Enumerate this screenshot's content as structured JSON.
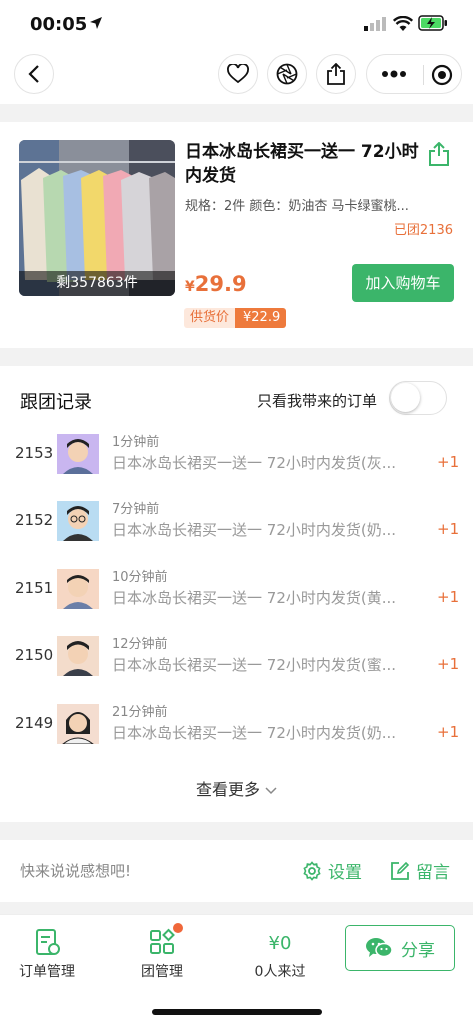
{
  "status_bar": {
    "time": "00:05"
  },
  "product": {
    "title": "日本冰岛长裙买一送一 72小时内发货",
    "spec": "规格：2件 颜色：奶油杏 马卡绿蜜桃...",
    "joined": "已团2136",
    "stock": "剩357863件",
    "price_currency": "¥",
    "price": "29.9",
    "add_to_cart": "加入购物车",
    "supply_label": "供货价",
    "supply_price": "¥22.9"
  },
  "records": {
    "title": "跟团记录",
    "only_mine_label": "只看我带来的订单",
    "only_mine_on": false,
    "items": [
      {
        "no": "2153",
        "ago": "1分钟前",
        "desc": "日本冰岛长裙买一送一 72小时内发货(灰...",
        "qty": "+1"
      },
      {
        "no": "2152",
        "ago": "7分钟前",
        "desc": "日本冰岛长裙买一送一 72小时内发货(奶...",
        "qty": "+1"
      },
      {
        "no": "2151",
        "ago": "10分钟前",
        "desc": "日本冰岛长裙买一送一 72小时内发货(黄...",
        "qty": "+1"
      },
      {
        "no": "2150",
        "ago": "12分钟前",
        "desc": "日本冰岛长裙买一送一 72小时内发货(蜜...",
        "qty": "+1"
      },
      {
        "no": "2149",
        "ago": "21分钟前",
        "desc": "日本冰岛长裙买一送一 72小时内发货(奶...",
        "qty": "+1"
      }
    ],
    "see_more": "查看更多"
  },
  "comment": {
    "hint": "快来说说感想吧!",
    "settings": "设置",
    "message": "留言"
  },
  "bottom": {
    "orders": "订单管理",
    "group": "团管理",
    "money": "¥0",
    "visitors": "0人来过",
    "share": "分享"
  },
  "colors": {
    "accent_green": "#3bb56a",
    "accent_orange": "#e8703a"
  }
}
